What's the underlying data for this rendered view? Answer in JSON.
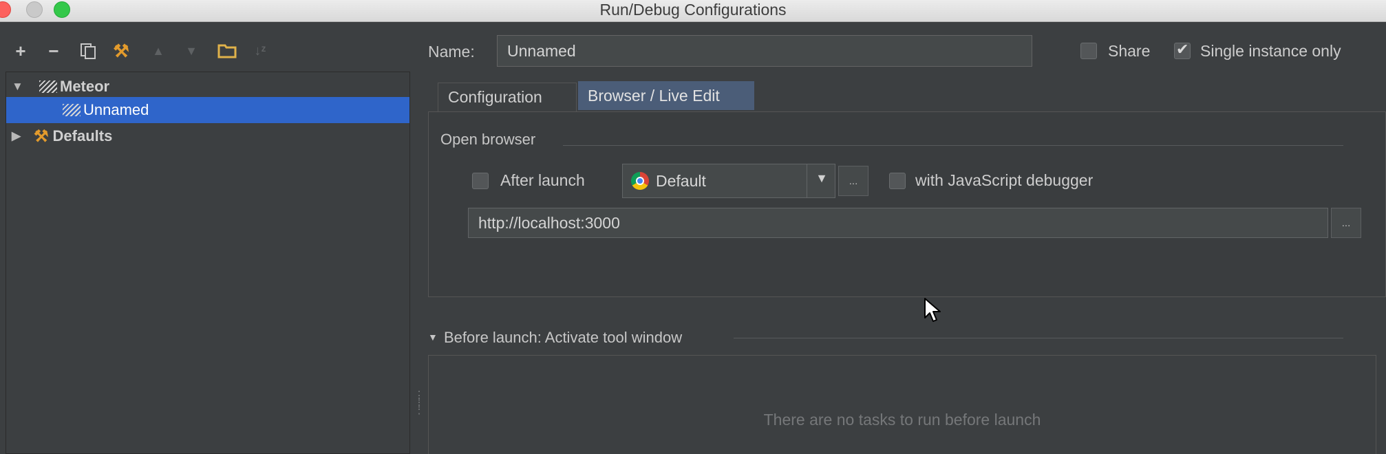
{
  "window": {
    "title": "Run/Debug Configurations"
  },
  "toolbar": {
    "add_icon": "plus-icon",
    "remove_icon": "minus-icon",
    "copy_icon": "copy-icon",
    "edit_defaults_icon": "wrench-icon",
    "move_up_icon": "arrow-up-icon",
    "move_down_icon": "arrow-down-icon",
    "folder_icon": "folder-icon",
    "sort_icon": "sort-icon"
  },
  "tree": {
    "nodes": [
      {
        "label": "Meteor",
        "expanded": true,
        "icon": "meteor-icon"
      },
      {
        "label": "Unnamed",
        "selected": true,
        "icon": "meteor-icon"
      },
      {
        "label": "Defaults",
        "expanded": false,
        "icon": "wrench-icon"
      }
    ]
  },
  "header": {
    "name_label": "Name:",
    "name_value": "Unnamed",
    "share_label": "Share",
    "share_checked": false,
    "single_instance_label": "Single instance only",
    "single_instance_checked": true
  },
  "tabs": [
    {
      "label": "Configuration",
      "active": false
    },
    {
      "label": "Browser / Live Edit",
      "active": true
    }
  ],
  "browser": {
    "group_title": "Open browser",
    "after_launch_label": "After launch",
    "after_launch_checked": false,
    "browser_value": "Default",
    "browse_label": "...",
    "js_debugger_label": "with JavaScript debugger",
    "js_debugger_checked": false,
    "url_value": "http://localhost:3000",
    "url_browse_label": "..."
  },
  "before_launch": {
    "title": "Before launch: Activate tool window",
    "empty_text": "There are no tasks to run before launch"
  },
  "colors": {
    "background": "#3c3f41",
    "selection": "#2f65ca",
    "active_tab": "#4b5d78"
  }
}
